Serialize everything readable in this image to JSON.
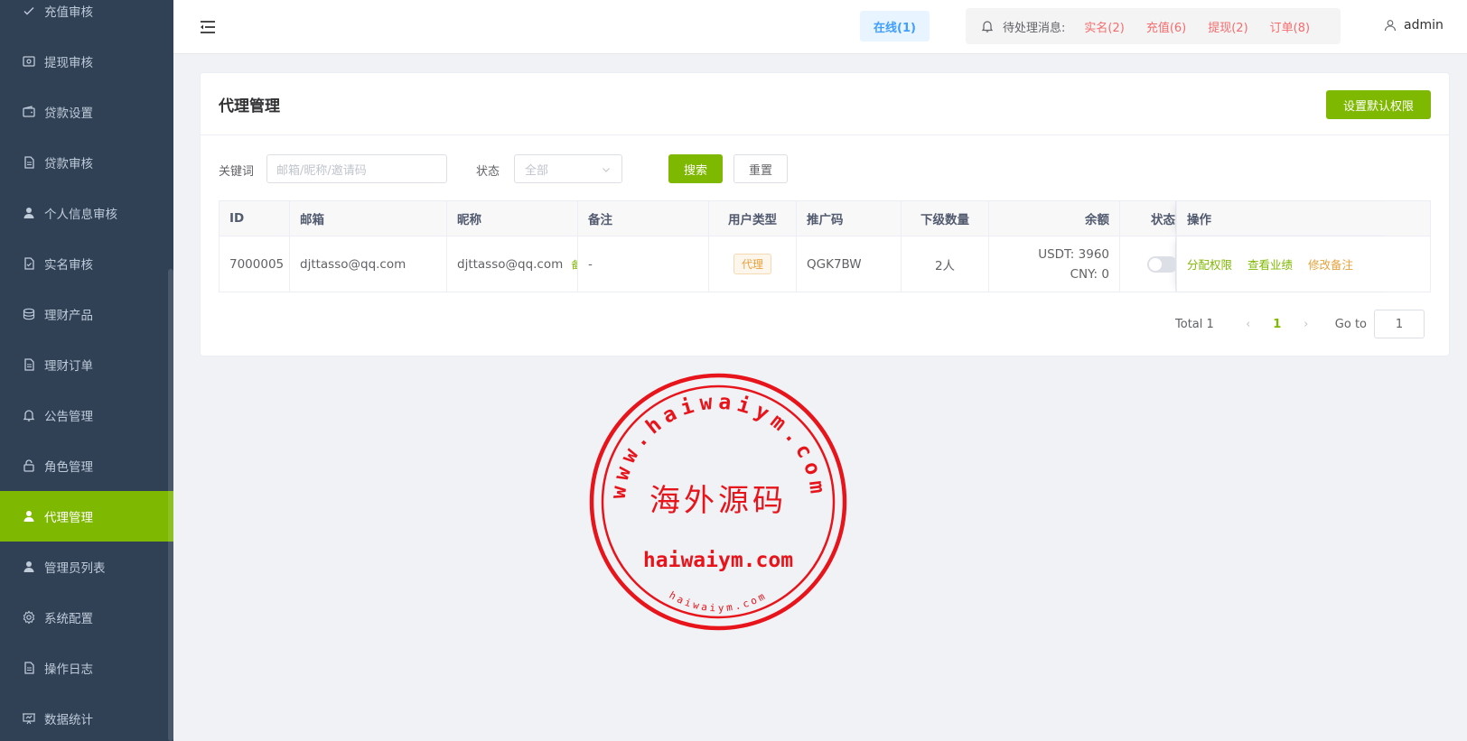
{
  "sidebar": {
    "items": [
      {
        "label": "充值审核",
        "icon": "check-icon",
        "active": false
      },
      {
        "label": "提现审核",
        "icon": "withdraw-icon",
        "active": false
      },
      {
        "label": "贷款设置",
        "icon": "wallet-icon",
        "active": false
      },
      {
        "label": "贷款审核",
        "icon": "document-icon",
        "active": false
      },
      {
        "label": "个人信息审核",
        "icon": "user-icon",
        "active": false
      },
      {
        "label": "实名审核",
        "icon": "document-check-icon",
        "active": false
      },
      {
        "label": "理财产品",
        "icon": "coins-icon",
        "active": false
      },
      {
        "label": "理财订单",
        "icon": "document-icon",
        "active": false
      },
      {
        "label": "公告管理",
        "icon": "bell-icon",
        "active": false
      },
      {
        "label": "角色管理",
        "icon": "lock-icon",
        "active": false
      },
      {
        "label": "代理管理",
        "icon": "user-icon",
        "active": true
      },
      {
        "label": "管理员列表",
        "icon": "user-icon",
        "active": false
      },
      {
        "label": "系统配置",
        "icon": "gear-icon",
        "active": false
      },
      {
        "label": "操作日志",
        "icon": "document-icon",
        "active": false
      },
      {
        "label": "数据统计",
        "icon": "presentation-icon",
        "active": false
      }
    ]
  },
  "header": {
    "online": "在线(1)",
    "pending_label": "待处理消息:",
    "pending_links": [
      "实名(2)",
      "充值(6)",
      "提现(2)",
      "订单(8)"
    ],
    "user": "admin"
  },
  "card": {
    "title": "代理管理",
    "default_perm_button": "设置默认权限"
  },
  "filter": {
    "keyword_label": "关键词",
    "keyword_placeholder": "邮箱/昵称/邀请码",
    "status_label": "状态",
    "status_value": "全部",
    "search_button": "搜索",
    "reset_button": "重置"
  },
  "table": {
    "headers": {
      "id": "ID",
      "email": "邮箱",
      "nickname": "昵称",
      "note": "备注",
      "user_type": "用户类型",
      "promo_code": "推广码",
      "sub_count": "下级数量",
      "balance": "余额",
      "status": "状态",
      "ops": "操作"
    },
    "rows": [
      {
        "id": "7000005",
        "email": "djttasso@qq.com",
        "nickname": "djttasso@qq.com",
        "nickname_tag": "备注",
        "note": "-",
        "user_type": "代理",
        "promo_code": "QGK7BW",
        "sub_count": "2人",
        "balance_usdt": "USDT: 3960",
        "balance_cny": "CNY: 0",
        "status_on": false,
        "ops": [
          "分配权限",
          "查看业绩",
          "修改备注"
        ]
      }
    ]
  },
  "pagination": {
    "total": "Total 1",
    "current": "1",
    "goto_label": "Go to",
    "goto_value": "1"
  },
  "watermark": {
    "center_text": "海外源码",
    "domain_text": "haiwaiym.com",
    "ring_text": "www.haiwaiym.com",
    "inner_ring_text": "haiwaiym.com",
    "color": "#e8141b"
  },
  "colors": {
    "sidebar_bg": "#304156",
    "accent": "#7fb800",
    "danger": "#f56c6c",
    "warning": "#e6a23c",
    "primary": "#409eff"
  }
}
